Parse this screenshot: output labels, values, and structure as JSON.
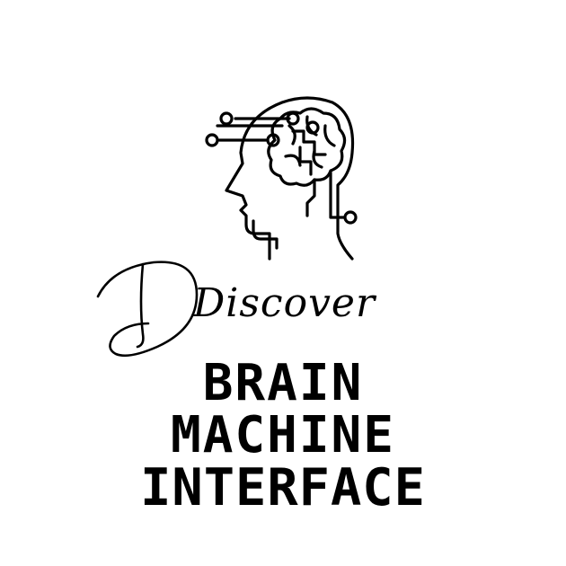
{
  "poster": {
    "script_word": "Discover",
    "title_lines": [
      "BRAIN",
      "MACHINE",
      "INTERFACE"
    ],
    "icon": "head-circuit-brain-icon",
    "colors": {
      "background": "#ffffff",
      "ink": "#000000"
    }
  }
}
